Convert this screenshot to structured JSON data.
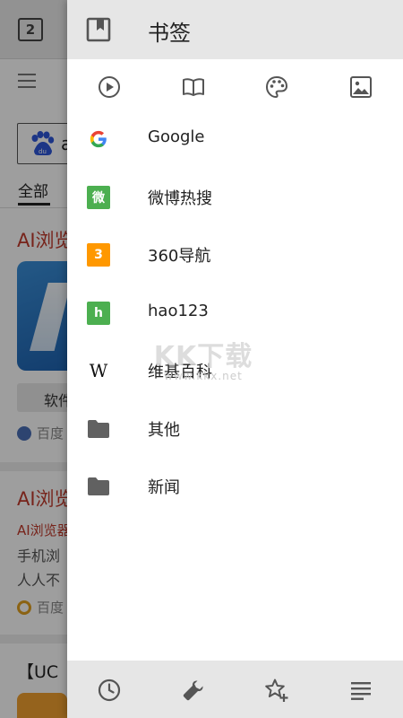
{
  "background": {
    "tab_count": "2",
    "search_letter": "a",
    "tab_all": "全部",
    "result1_title": "AI浏览",
    "result1_chip": "软件",
    "result1_source": "百度",
    "result2_title": "AI浏览",
    "result2_line1": "AI浏览器",
    "result2_line2": "手机浏",
    "result2_line3": "人人不",
    "result2_source": "百度",
    "result3_title": "【UC"
  },
  "drawer": {
    "header_title": "书签",
    "categories": [
      {
        "icon": "play-circle-icon"
      },
      {
        "icon": "book-icon"
      },
      {
        "icon": "palette-icon"
      },
      {
        "icon": "image-icon"
      }
    ],
    "bookmarks": [
      {
        "label": "Google",
        "icon": "google-icon"
      },
      {
        "label": "微博热搜",
        "icon": "weibo-icon",
        "badge": "微",
        "color": "#4caf50"
      },
      {
        "label": "360导航",
        "icon": "360-icon",
        "badge": "3",
        "color": "#ff9800"
      },
      {
        "label": "hao123",
        "icon": "hao123-icon",
        "badge": "h",
        "color": "#4caf50"
      },
      {
        "label": "维基百科",
        "icon": "wikipedia-icon",
        "badge": "W"
      },
      {
        "label": "其他",
        "icon": "folder-icon"
      },
      {
        "label": "新闻",
        "icon": "folder-icon"
      }
    ],
    "watermark": {
      "main": "KK下载",
      "sub": "www.kkx.net"
    },
    "bottom_bar": [
      {
        "icon": "history-clock-icon"
      },
      {
        "icon": "wrench-icon"
      },
      {
        "icon": "star-add-icon"
      },
      {
        "icon": "list-icon"
      }
    ]
  }
}
